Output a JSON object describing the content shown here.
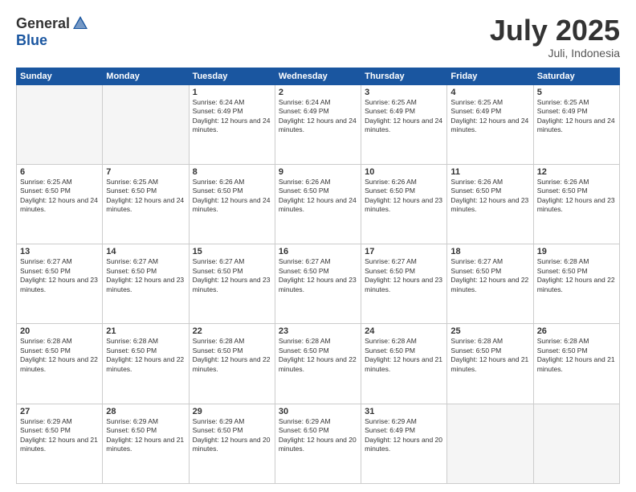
{
  "logo": {
    "general": "General",
    "blue": "Blue"
  },
  "header": {
    "month": "July 2025",
    "location": "Juli, Indonesia"
  },
  "weekdays": [
    "Sunday",
    "Monday",
    "Tuesday",
    "Wednesday",
    "Thursday",
    "Friday",
    "Saturday"
  ],
  "weeks": [
    [
      {
        "day": "",
        "sunrise": "",
        "sunset": "",
        "daylight": "",
        "empty": true
      },
      {
        "day": "",
        "sunrise": "",
        "sunset": "",
        "daylight": "",
        "empty": true
      },
      {
        "day": "1",
        "sunrise": "Sunrise: 6:24 AM",
        "sunset": "Sunset: 6:49 PM",
        "daylight": "Daylight: 12 hours and 24 minutes.",
        "empty": false
      },
      {
        "day": "2",
        "sunrise": "Sunrise: 6:24 AM",
        "sunset": "Sunset: 6:49 PM",
        "daylight": "Daylight: 12 hours and 24 minutes.",
        "empty": false
      },
      {
        "day": "3",
        "sunrise": "Sunrise: 6:25 AM",
        "sunset": "Sunset: 6:49 PM",
        "daylight": "Daylight: 12 hours and 24 minutes.",
        "empty": false
      },
      {
        "day": "4",
        "sunrise": "Sunrise: 6:25 AM",
        "sunset": "Sunset: 6:49 PM",
        "daylight": "Daylight: 12 hours and 24 minutes.",
        "empty": false
      },
      {
        "day": "5",
        "sunrise": "Sunrise: 6:25 AM",
        "sunset": "Sunset: 6:49 PM",
        "daylight": "Daylight: 12 hours and 24 minutes.",
        "empty": false
      }
    ],
    [
      {
        "day": "6",
        "sunrise": "Sunrise: 6:25 AM",
        "sunset": "Sunset: 6:50 PM",
        "daylight": "Daylight: 12 hours and 24 minutes.",
        "empty": false
      },
      {
        "day": "7",
        "sunrise": "Sunrise: 6:25 AM",
        "sunset": "Sunset: 6:50 PM",
        "daylight": "Daylight: 12 hours and 24 minutes.",
        "empty": false
      },
      {
        "day": "8",
        "sunrise": "Sunrise: 6:26 AM",
        "sunset": "Sunset: 6:50 PM",
        "daylight": "Daylight: 12 hours and 24 minutes.",
        "empty": false
      },
      {
        "day": "9",
        "sunrise": "Sunrise: 6:26 AM",
        "sunset": "Sunset: 6:50 PM",
        "daylight": "Daylight: 12 hours and 24 minutes.",
        "empty": false
      },
      {
        "day": "10",
        "sunrise": "Sunrise: 6:26 AM",
        "sunset": "Sunset: 6:50 PM",
        "daylight": "Daylight: 12 hours and 23 minutes.",
        "empty": false
      },
      {
        "day": "11",
        "sunrise": "Sunrise: 6:26 AM",
        "sunset": "Sunset: 6:50 PM",
        "daylight": "Daylight: 12 hours and 23 minutes.",
        "empty": false
      },
      {
        "day": "12",
        "sunrise": "Sunrise: 6:26 AM",
        "sunset": "Sunset: 6:50 PM",
        "daylight": "Daylight: 12 hours and 23 minutes.",
        "empty": false
      }
    ],
    [
      {
        "day": "13",
        "sunrise": "Sunrise: 6:27 AM",
        "sunset": "Sunset: 6:50 PM",
        "daylight": "Daylight: 12 hours and 23 minutes.",
        "empty": false
      },
      {
        "day": "14",
        "sunrise": "Sunrise: 6:27 AM",
        "sunset": "Sunset: 6:50 PM",
        "daylight": "Daylight: 12 hours and 23 minutes.",
        "empty": false
      },
      {
        "day": "15",
        "sunrise": "Sunrise: 6:27 AM",
        "sunset": "Sunset: 6:50 PM",
        "daylight": "Daylight: 12 hours and 23 minutes.",
        "empty": false
      },
      {
        "day": "16",
        "sunrise": "Sunrise: 6:27 AM",
        "sunset": "Sunset: 6:50 PM",
        "daylight": "Daylight: 12 hours and 23 minutes.",
        "empty": false
      },
      {
        "day": "17",
        "sunrise": "Sunrise: 6:27 AM",
        "sunset": "Sunset: 6:50 PM",
        "daylight": "Daylight: 12 hours and 23 minutes.",
        "empty": false
      },
      {
        "day": "18",
        "sunrise": "Sunrise: 6:27 AM",
        "sunset": "Sunset: 6:50 PM",
        "daylight": "Daylight: 12 hours and 22 minutes.",
        "empty": false
      },
      {
        "day": "19",
        "sunrise": "Sunrise: 6:28 AM",
        "sunset": "Sunset: 6:50 PM",
        "daylight": "Daylight: 12 hours and 22 minutes.",
        "empty": false
      }
    ],
    [
      {
        "day": "20",
        "sunrise": "Sunrise: 6:28 AM",
        "sunset": "Sunset: 6:50 PM",
        "daylight": "Daylight: 12 hours and 22 minutes.",
        "empty": false
      },
      {
        "day": "21",
        "sunrise": "Sunrise: 6:28 AM",
        "sunset": "Sunset: 6:50 PM",
        "daylight": "Daylight: 12 hours and 22 minutes.",
        "empty": false
      },
      {
        "day": "22",
        "sunrise": "Sunrise: 6:28 AM",
        "sunset": "Sunset: 6:50 PM",
        "daylight": "Daylight: 12 hours and 22 minutes.",
        "empty": false
      },
      {
        "day": "23",
        "sunrise": "Sunrise: 6:28 AM",
        "sunset": "Sunset: 6:50 PM",
        "daylight": "Daylight: 12 hours and 22 minutes.",
        "empty": false
      },
      {
        "day": "24",
        "sunrise": "Sunrise: 6:28 AM",
        "sunset": "Sunset: 6:50 PM",
        "daylight": "Daylight: 12 hours and 21 minutes.",
        "empty": false
      },
      {
        "day": "25",
        "sunrise": "Sunrise: 6:28 AM",
        "sunset": "Sunset: 6:50 PM",
        "daylight": "Daylight: 12 hours and 21 minutes.",
        "empty": false
      },
      {
        "day": "26",
        "sunrise": "Sunrise: 6:28 AM",
        "sunset": "Sunset: 6:50 PM",
        "daylight": "Daylight: 12 hours and 21 minutes.",
        "empty": false
      }
    ],
    [
      {
        "day": "27",
        "sunrise": "Sunrise: 6:29 AM",
        "sunset": "Sunset: 6:50 PM",
        "daylight": "Daylight: 12 hours and 21 minutes.",
        "empty": false
      },
      {
        "day": "28",
        "sunrise": "Sunrise: 6:29 AM",
        "sunset": "Sunset: 6:50 PM",
        "daylight": "Daylight: 12 hours and 21 minutes.",
        "empty": false
      },
      {
        "day": "29",
        "sunrise": "Sunrise: 6:29 AM",
        "sunset": "Sunset: 6:50 PM",
        "daylight": "Daylight: 12 hours and 20 minutes.",
        "empty": false
      },
      {
        "day": "30",
        "sunrise": "Sunrise: 6:29 AM",
        "sunset": "Sunset: 6:50 PM",
        "daylight": "Daylight: 12 hours and 20 minutes.",
        "empty": false
      },
      {
        "day": "31",
        "sunrise": "Sunrise: 6:29 AM",
        "sunset": "Sunset: 6:49 PM",
        "daylight": "Daylight: 12 hours and 20 minutes.",
        "empty": false
      },
      {
        "day": "",
        "sunrise": "",
        "sunset": "",
        "daylight": "",
        "empty": true
      },
      {
        "day": "",
        "sunrise": "",
        "sunset": "",
        "daylight": "",
        "empty": true
      }
    ]
  ]
}
